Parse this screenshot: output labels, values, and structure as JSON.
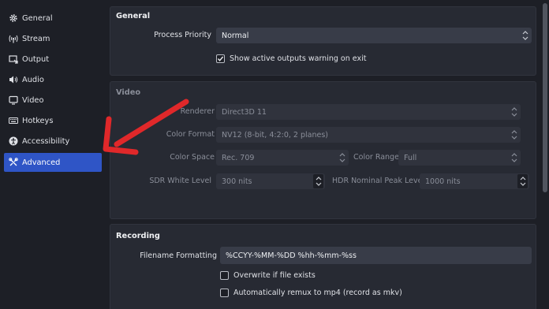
{
  "sidebar": {
    "items": [
      {
        "label": "General",
        "icon": "gear-icon",
        "active": false
      },
      {
        "label": "Stream",
        "icon": "antenna-icon",
        "active": false
      },
      {
        "label": "Output",
        "icon": "output-icon",
        "active": false
      },
      {
        "label": "Audio",
        "icon": "speaker-icon",
        "active": false
      },
      {
        "label": "Video",
        "icon": "monitor-icon",
        "active": false
      },
      {
        "label": "Hotkeys",
        "icon": "keyboard-icon",
        "active": false
      },
      {
        "label": "Accessibility",
        "icon": "accessibility-icon",
        "active": false
      },
      {
        "label": "Advanced",
        "icon": "tools-icon",
        "active": true
      }
    ]
  },
  "general": {
    "title": "General",
    "process_priority_label": "Process Priority",
    "process_priority_value": "Normal",
    "show_warning_label": "Show active outputs warning on exit",
    "show_warning_checked": true
  },
  "video": {
    "title": "Video",
    "renderer_label": "Renderer",
    "renderer_value": "Direct3D 11",
    "color_format_label": "Color Format",
    "color_format_value": "NV12 (8-bit, 4:2:0, 2 planes)",
    "color_space_label": "Color Space",
    "color_space_value": "Rec. 709",
    "color_range_label": "Color Range",
    "color_range_value": "Full",
    "sdr_white_label": "SDR White Level",
    "sdr_white_value": "300 nits",
    "hdr_peak_label": "HDR Nominal Peak Level",
    "hdr_peak_value": "1000 nits"
  },
  "recording": {
    "title": "Recording",
    "filename_label": "Filename Formatting",
    "filename_value": "%CCYY-%MM-%DD %hh-%mm-%ss",
    "overwrite_label": "Overwrite if file exists",
    "overwrite_checked": false,
    "remux_label": "Automatically remux to mp4 (record as mkv)",
    "remux_checked": false
  },
  "colors": {
    "accent": "#2f55c6",
    "panel": "#272a33",
    "background": "#1d1f26",
    "annotation_arrow": "#e0282a"
  }
}
